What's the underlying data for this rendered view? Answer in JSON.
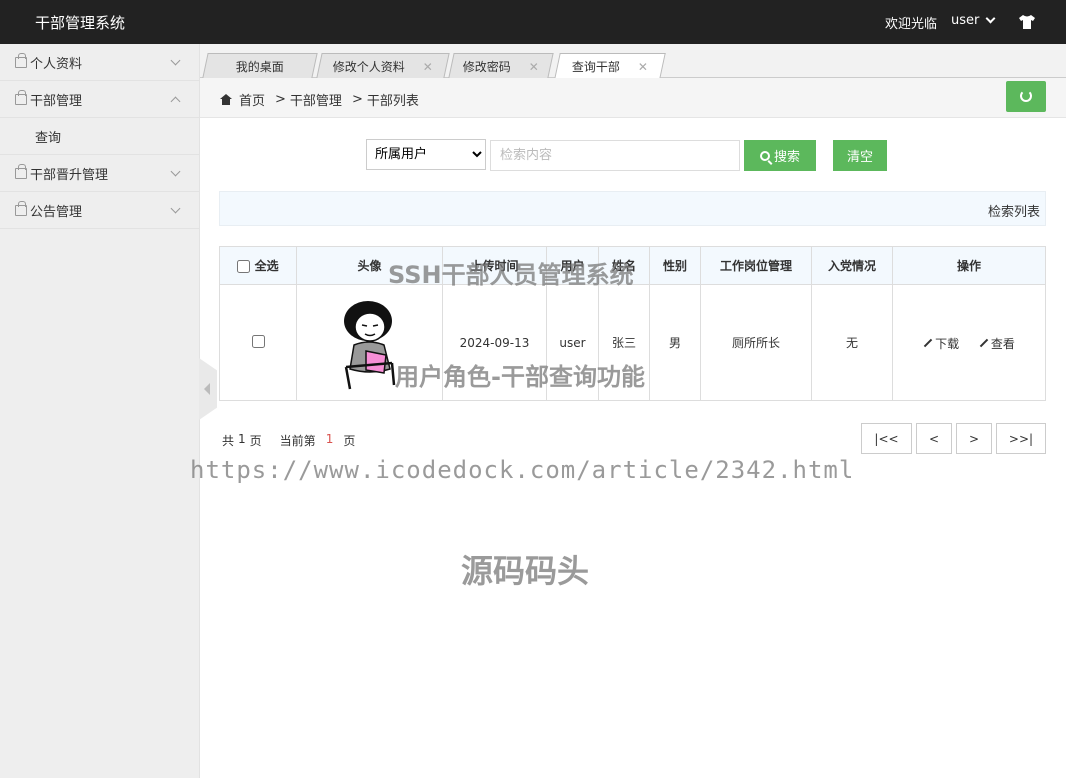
{
  "header": {
    "brand": "干部管理系统",
    "welcome": "欢迎光临",
    "user": "user"
  },
  "sidebar": {
    "items": [
      {
        "label": "个人资料"
      },
      {
        "label": "干部管理",
        "sub": "查询"
      },
      {
        "label": "干部晋升管理"
      },
      {
        "label": "公告管理"
      }
    ]
  },
  "tabs": [
    {
      "label": "我的桌面"
    },
    {
      "label": "修改个人资料"
    },
    {
      "label": "修改密码"
    },
    {
      "label": "查询干部"
    }
  ],
  "breadcrumb": {
    "home": "首页",
    "sep": ">",
    "section": "干部管理",
    "page": "干部列表"
  },
  "search": {
    "select_value": "所属用户",
    "placeholder": "检索内容",
    "search_label": "搜索",
    "clear_label": "清空"
  },
  "results_label": "检索列表",
  "table": {
    "headers": [
      "全选",
      "头像",
      "上传时间",
      "用户",
      "姓名",
      "性别",
      "工作岗位管理",
      "入党情况",
      "操作"
    ],
    "rows": [
      {
        "time": "2024-09-13",
        "user": "user",
        "name": "张三",
        "gender": "男",
        "position": "厕所所长",
        "party": "无",
        "download": "下载",
        "view": "查看"
      }
    ]
  },
  "pagination": {
    "total_prefix": "共",
    "total": "1",
    "page_unit": "页",
    "current_prefix": "当前第",
    "current": "1",
    "first": "|<<",
    "prev": "<",
    "next": ">",
    "last": ">>|"
  },
  "watermarks": {
    "title": "SSH干部人员管理系统",
    "subtitle": "用户角色-干部查询功能",
    "url": "https://www.icodedock.com/article/2342.html",
    "source": "源码码头"
  },
  "colors": {
    "header_bg": "#222222",
    "green": "#5cb85c",
    "current_page": "#d9534f"
  }
}
